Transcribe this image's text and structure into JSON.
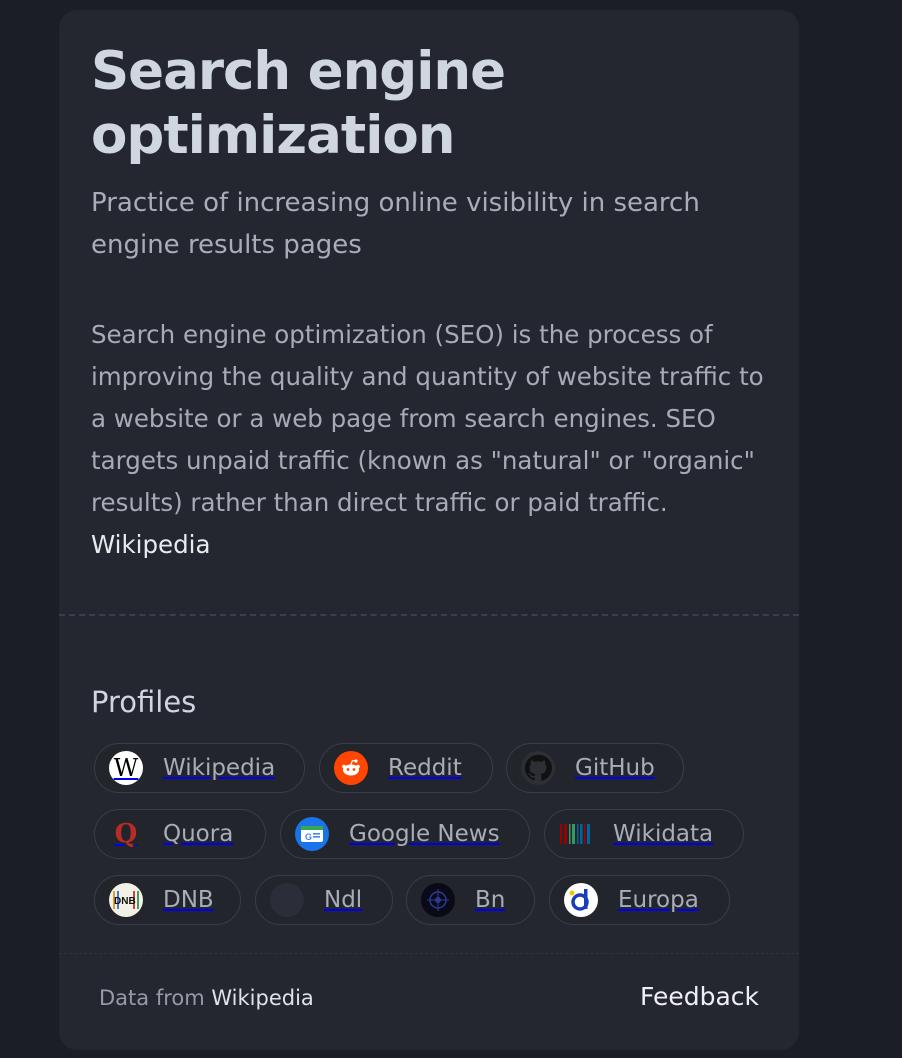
{
  "panel": {
    "title": "Search engine optimization",
    "subtitle": "Practice of increasing online visibility in search engine results pages",
    "description": "Search engine optimization (SEO) is the process of improving the quality and quantity of website traffic to a website or a web page from search engines. SEO targets unpaid traffic (known as \"natural\" or \"organic\" results) rather than direct traffic or paid traffic.",
    "source_link": "Wikipedia"
  },
  "profiles": {
    "heading": "Profiles",
    "items": [
      {
        "label": "Wikipedia",
        "icon": "wikipedia-icon"
      },
      {
        "label": "Reddit",
        "icon": "reddit-icon"
      },
      {
        "label": "GitHub",
        "icon": "github-icon"
      },
      {
        "label": "Quora",
        "icon": "quora-icon"
      },
      {
        "label": "Google News",
        "icon": "google-news-icon"
      },
      {
        "label": "Wikidata",
        "icon": "wikidata-icon"
      },
      {
        "label": "DNB",
        "icon": "dnb-icon"
      },
      {
        "label": "Ndl",
        "icon": "ndl-icon"
      },
      {
        "label": "Bn",
        "icon": "bn-icon"
      },
      {
        "label": "Europa",
        "icon": "europa-icon"
      }
    ]
  },
  "footer": {
    "data_from_prefix": "Data from",
    "data_from_link": "Wikipedia",
    "feedback": "Feedback"
  },
  "colors": {
    "page_background": "#1b1e25",
    "card_background": "#252730",
    "title_text": "#cfd6df",
    "body_text": "#a7abb5",
    "chip_border": "#3a3d47"
  }
}
